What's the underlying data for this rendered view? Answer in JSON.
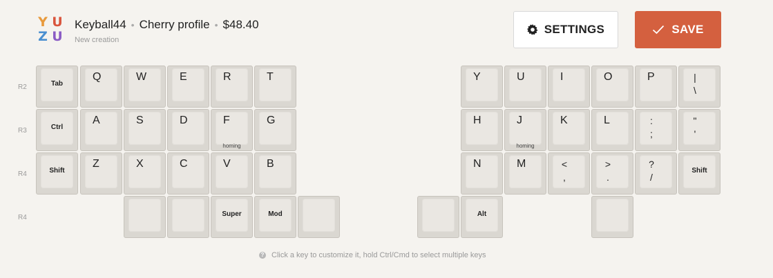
{
  "header": {
    "logo_letters": [
      "Y",
      "U",
      "Z",
      "U"
    ],
    "logo_colors": [
      "#e89a3c",
      "#d9553d",
      "#4a8fd0",
      "#8a5bc4"
    ],
    "keyboard_name": "Keyball44",
    "profile": "Cherry profile",
    "price": "$48.40",
    "subtitle": "New creation",
    "settings_label": "SETTINGS",
    "settings_icon": "gear-icon",
    "save_label": "SAVE",
    "save_icon": "check-icon",
    "accent_color": "#d4603f"
  },
  "row_labels": [
    "R2",
    "R3",
    "R4",
    "R4"
  ],
  "keys": {
    "tab": "Tab",
    "q": "Q",
    "w": "W",
    "e": "E",
    "r": "R",
    "t": "T",
    "y": "Y",
    "u": "U",
    "i": "I",
    "o": "O",
    "p": "P",
    "pipe_top": "|",
    "pipe_bottom": "\\",
    "ctrl": "Ctrl",
    "a": "A",
    "s": "S",
    "d": "D",
    "f": "F",
    "g": "G",
    "h": "H",
    "j": "J",
    "k": "K",
    "l": "L",
    "semi_top": ":",
    "semi_bottom": ";",
    "quote_top": "\"",
    "quote_bottom": "'",
    "shift_left": "Shift",
    "z": "Z",
    "x": "X",
    "c": "C",
    "v": "V",
    "b": "B",
    "n": "N",
    "m": "M",
    "lt_top": "<",
    "lt_bottom": ",",
    "gt_top": ">",
    "gt_bottom": ".",
    "q_top": "?",
    "q_bottom": "/",
    "shift_right": "Shift",
    "super": "Super",
    "mod": "Mod",
    "alt": "Alt",
    "homing": "homing"
  },
  "hint": {
    "icon": "question-icon",
    "text": "Click a key to customize it, hold Ctrl/Cmd to select multiple keys"
  }
}
